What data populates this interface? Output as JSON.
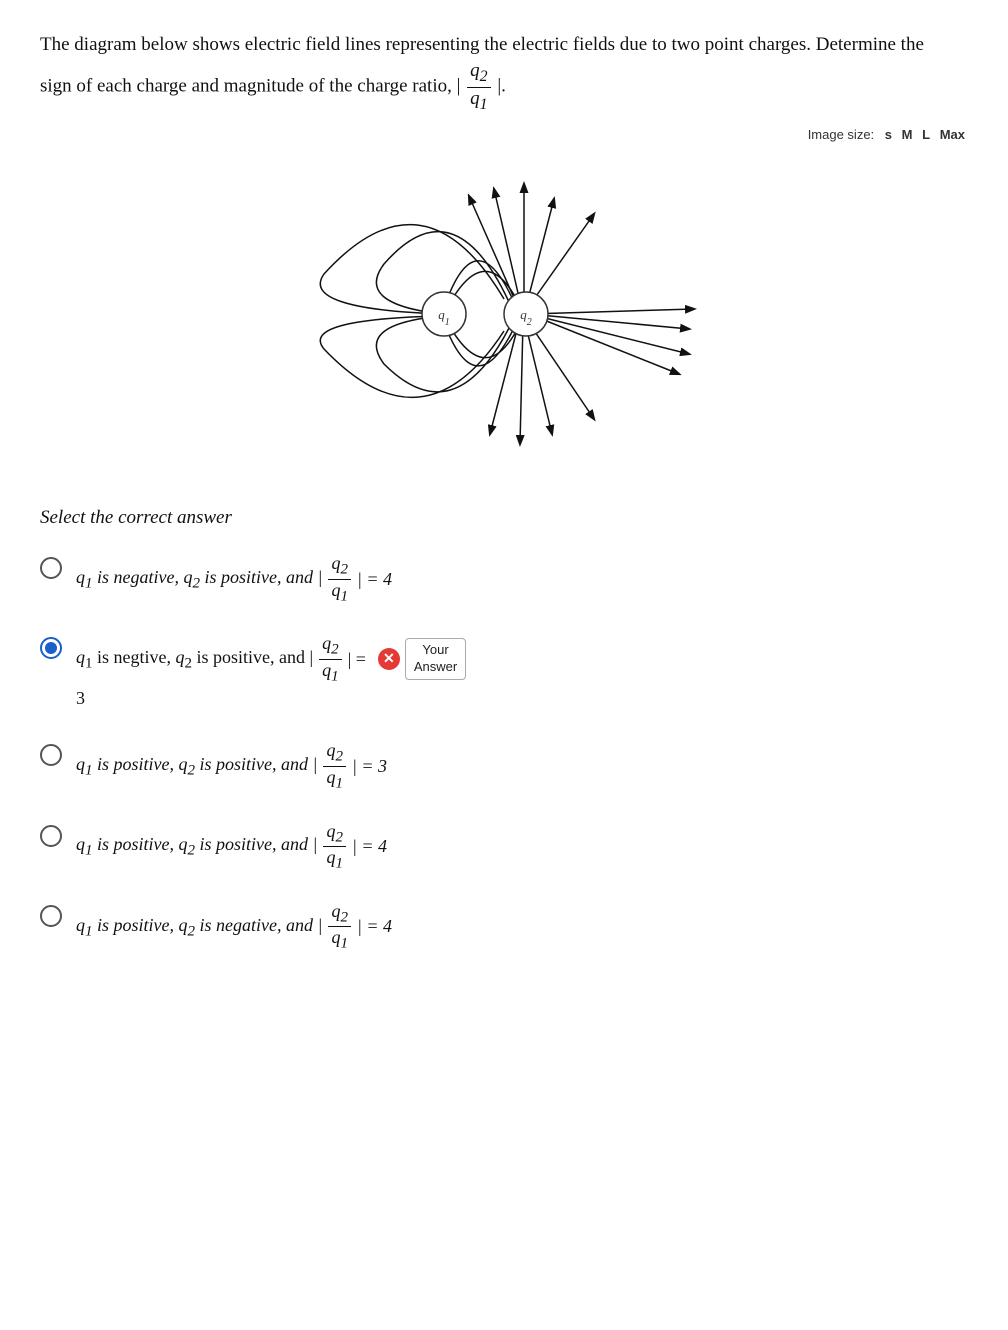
{
  "question": {
    "intro": "The diagram below shows electric field lines representing the electric fields due to two point charges.  Determine the sign of each charge and magnitude of the charge ratio, |",
    "fraction_label": "q2/q1",
    "fraction_num": "q2",
    "fraction_den": "q1",
    "end_text": "|."
  },
  "image_size": {
    "label": "Image size:",
    "options": [
      "s",
      "M",
      "L",
      "Max"
    ]
  },
  "select_label": "Select the correct answer",
  "options": [
    {
      "id": "opt1",
      "selected": false,
      "text_parts": [
        "q1 is negative, q2 is positive, and |",
        "q2/q1",
        "| = 4"
      ],
      "value": "4_neg_pos"
    },
    {
      "id": "opt2",
      "selected": true,
      "text_parts": [
        "q1 is negtive, q2 is positive, and |",
        "q2/q1",
        "| =",
        "3"
      ],
      "value": "3_neg_pos",
      "your_answer": true
    },
    {
      "id": "opt3",
      "selected": false,
      "text_parts": [
        "q1 is positive, q2 is positive, and |",
        "q2/q1",
        "| = 3"
      ],
      "value": "3_pos_pos"
    },
    {
      "id": "opt4",
      "selected": false,
      "text_parts": [
        "q1 is positive, q2 is positive, and |",
        "q2/q1",
        "| = 4"
      ],
      "value": "4_pos_pos"
    },
    {
      "id": "opt5",
      "selected": false,
      "text_parts": [
        "q1 is positive, q2 is negative, and |",
        "q2/q1",
        "| = 4"
      ],
      "value": "4_pos_neg"
    }
  ],
  "your_answer_label": "Your\nAnswer"
}
